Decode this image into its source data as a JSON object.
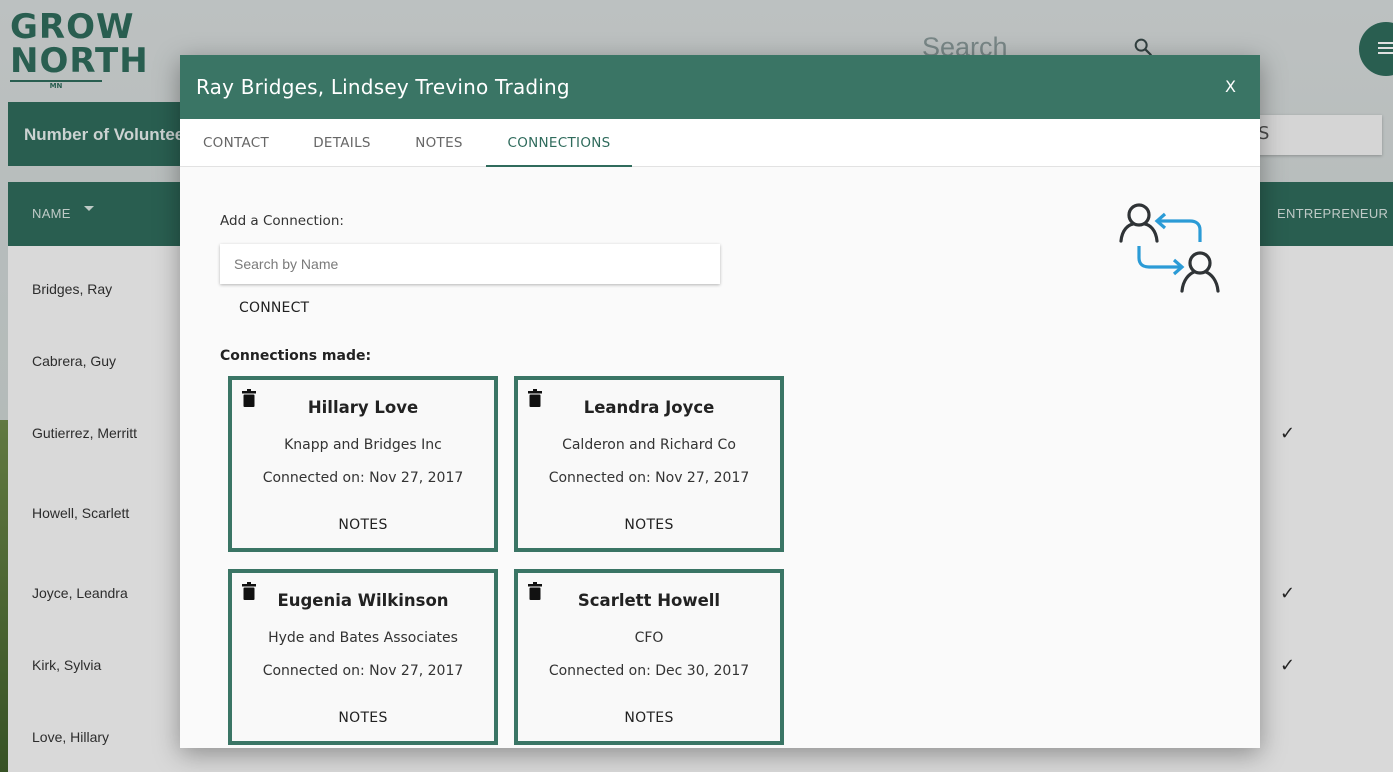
{
  "background": {
    "logo": {
      "line1": "GROW",
      "line2": "NORTH",
      "line3": "MN"
    },
    "search_placeholder": "Search",
    "count_label": "Number of Voluntee",
    "right_box_text": "S",
    "table": {
      "col_name": "NAME",
      "col_entrepreneur": "ENTREPRENEUR",
      "rows": [
        {
          "name": "Bridges, Ray",
          "check": ""
        },
        {
          "name": "Cabrera, Guy",
          "check": ""
        },
        {
          "name": "Gutierrez, Merritt",
          "check": "✓"
        },
        {
          "name": "Howell, Scarlett",
          "check": ""
        },
        {
          "name": "Joyce, Leandra",
          "check": "✓"
        },
        {
          "name": "Kirk, Sylvia",
          "check": "✓"
        },
        {
          "name": "Love, Hillary",
          "check": ""
        }
      ]
    }
  },
  "modal": {
    "title": "Ray Bridges, Lindsey Trevino Trading",
    "close_label": "X",
    "tabs": [
      {
        "label": "CONTACT",
        "active": false
      },
      {
        "label": "DETAILS",
        "active": false
      },
      {
        "label": "NOTES",
        "active": false
      },
      {
        "label": "CONNECTIONS",
        "active": true
      }
    ],
    "add_connection_label": "Add a Connection:",
    "search_placeholder": "Search by Name",
    "connect_label": "CONNECT",
    "connections_made_label": "Connections made:",
    "connections": [
      {
        "name": "Hillary Love",
        "org": "Knapp and Bridges Inc",
        "connected": "Connected on: Nov 27, 2017",
        "notes_label": "NOTES"
      },
      {
        "name": "Leandra Joyce",
        "org": "Calderon and Richard Co",
        "connected": "Connected on: Nov 27, 2017",
        "notes_label": "NOTES"
      },
      {
        "name": "Eugenia Wilkinson",
        "org": "Hyde and Bates Associates",
        "connected": "Connected on: Nov 27, 2017",
        "notes_label": "NOTES"
      },
      {
        "name": "Scarlett Howell",
        "org": "CFO",
        "connected": "Connected on: Dec 30, 2017",
        "notes_label": "NOTES"
      }
    ]
  },
  "colors": {
    "brand_green": "#3a7565",
    "accent_blue": "#2b9bd6",
    "icon_dark": "#2f3336"
  }
}
